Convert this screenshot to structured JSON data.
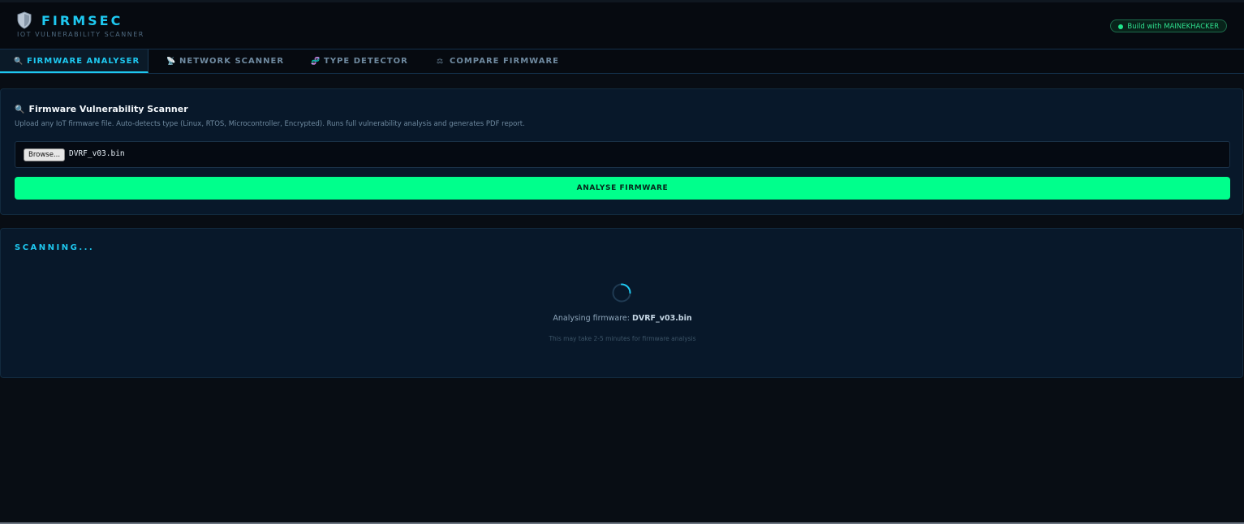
{
  "header": {
    "title": "FIRMSEC",
    "subtitle": "IOT VULNERABILITY SCANNER",
    "badge": "Build with MAINEKHACKER",
    "brand_icon": "shield-icon"
  },
  "tabs": [
    {
      "label": "FIRMWARE ANALYSER",
      "icon": "magnifier-icon",
      "active": true
    },
    {
      "label": "NETWORK SCANNER",
      "icon": "satellite-icon",
      "active": false
    },
    {
      "label": "TYPE DETECTOR",
      "icon": "dna-icon",
      "active": false
    },
    {
      "label": "COMPARE FIRMWARE",
      "icon": "scales-icon",
      "active": false
    }
  ],
  "scanner": {
    "title": "Firmware Vulnerability Scanner",
    "description": "Upload any IoT firmware file. Auto-detects type (Linux, RTOS, Microcontroller, Encrypted). Runs full vulnerability analysis and generates PDF report.",
    "browse_label": "Browse...",
    "file_name": "DVRF_v03.bin",
    "analyse_label": "ANALYSE FIRMWARE"
  },
  "progress": {
    "status": "SCANNING...",
    "message_prefix": "Analysing firmware: ",
    "file_name": "DVRF_v03.bin",
    "hint": "This may take 2-5 minutes for firmware analysis"
  },
  "colors": {
    "accent": "#1ec8f0",
    "button": "#00ff8c",
    "badge": "#2fe08f",
    "background": "#080d14"
  }
}
